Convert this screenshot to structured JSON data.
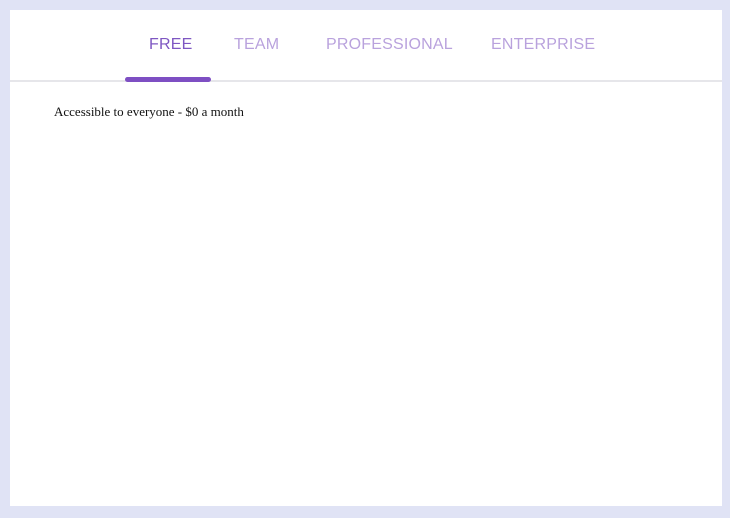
{
  "tabs": [
    {
      "label": "FREE",
      "active": true
    },
    {
      "label": "TEAM",
      "active": false
    },
    {
      "label": "PROFESSIONAL",
      "active": false
    },
    {
      "label": "ENTERPRISE",
      "active": false
    }
  ],
  "panel": {
    "description": "Accessible to everyone - $0 a month"
  },
  "colors": {
    "page_background": "#e0e3f5",
    "active_tab": "#7e57c2",
    "inactive_tab": "#b9a2dd",
    "indicator": "#7e4fc3"
  }
}
